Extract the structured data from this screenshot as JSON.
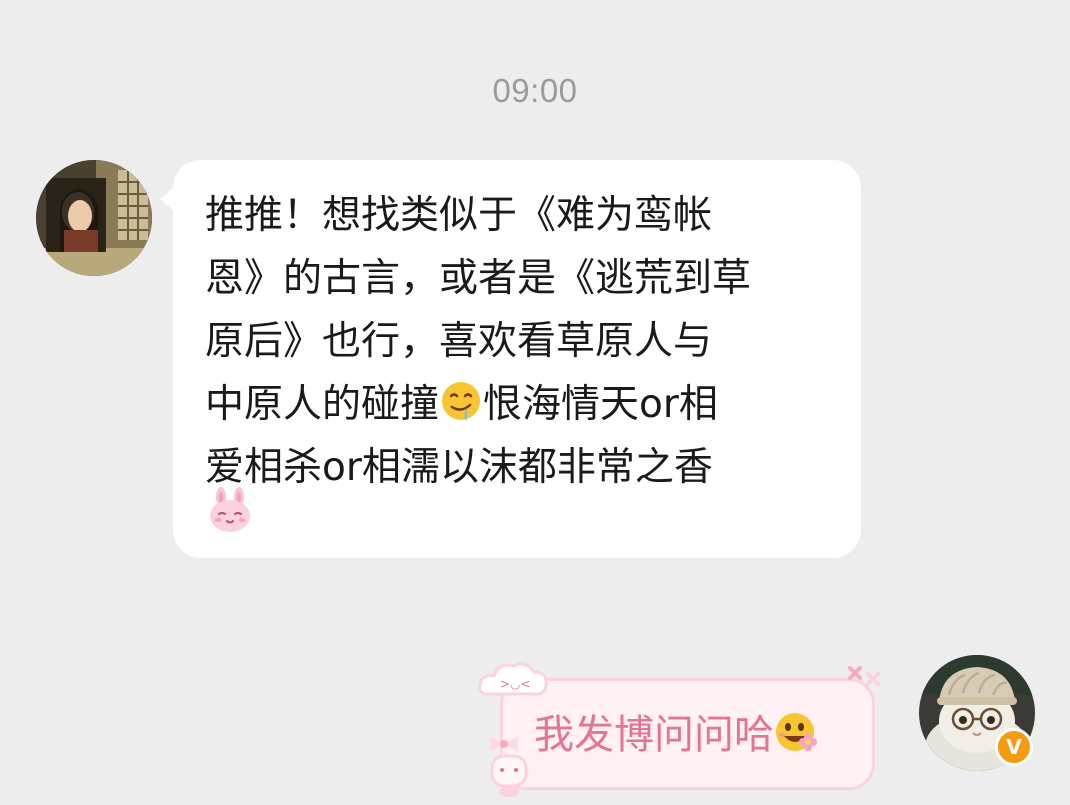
{
  "chat": {
    "timestamp": "09:00",
    "incoming": {
      "avatar_icon": "woman-portrait-avatar",
      "line1": "推推！想找类似于《难为鸾帐",
      "line2": "恩》的古言，或者是《逃荒到草",
      "line3": "原后》也行，喜欢看草原人与",
      "line4a": "中原人的碰撞",
      "line4_emoji": "drooling-face",
      "line4b": "恨海情天or相",
      "line5": "爱相杀or相濡以沫都非常之香",
      "trailing_emoji": "pink-bunny-face"
    },
    "outgoing": {
      "avatar_icon": "cat-with-hat-avatar",
      "text": "我发博问问哈",
      "emoji": "smiling-face-with-flower",
      "verified_badge": "V",
      "bubble_style": "pink-sticker-frame"
    }
  },
  "colors": {
    "background": "#ededed",
    "bubble": "#ffffff",
    "timestamp": "#9a9a9a",
    "pink_text": "#e27594",
    "pink_border": "#fbd2dd",
    "badge": "#f39c12"
  }
}
